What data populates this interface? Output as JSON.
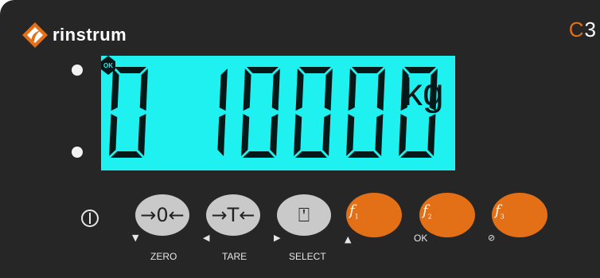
{
  "header": {
    "brand": "rinstrum",
    "model_letter": "C",
    "model_number": "3"
  },
  "display": {
    "reading": "0 10000",
    "unit": "kg",
    "badge": "OK",
    "colors": {
      "lcd": "#1ff0f0",
      "segments": "#061818"
    }
  },
  "keys": [
    {
      "id": "zero",
      "symbol": "→0←",
      "label": "ZERO",
      "arrow": "▼"
    },
    {
      "id": "tare",
      "symbol": "→T←",
      "label": "TARE",
      "arrow": "◀"
    },
    {
      "id": "select",
      "symbol": "⍞",
      "label": "SELECT",
      "arrow": "▶"
    },
    {
      "id": "f1",
      "fn": "f",
      "sub": "1",
      "label": "",
      "arrow": "▲"
    },
    {
      "id": "f2",
      "fn": "f",
      "sub": "2",
      "label": "OK",
      "arrow": ""
    },
    {
      "id": "f3",
      "fn": "f",
      "sub": "3",
      "label": "",
      "arrow": "⊘"
    }
  ],
  "colors": {
    "panel": "#262626",
    "accent": "#e36f17",
    "grey_key": "#c9c9c9"
  },
  "icons": [
    "rinstrum-logo-icon",
    "power-icon",
    "ok-badge-icon"
  ]
}
